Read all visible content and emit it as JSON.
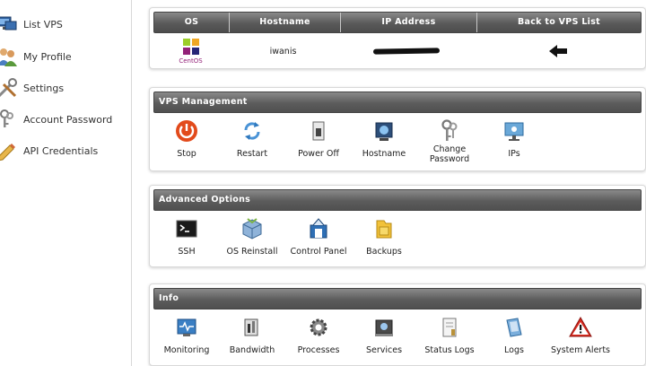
{
  "sidebar": {
    "items": [
      {
        "label": "List VPS",
        "icon": "monitor-icon"
      },
      {
        "label": "My Profile",
        "icon": "users-icon"
      },
      {
        "label": "Settings",
        "icon": "tools-icon"
      },
      {
        "label": "Account Password",
        "icon": "keys-icon"
      },
      {
        "label": "API Credentials",
        "icon": "pencil-icon"
      }
    ]
  },
  "vps_table": {
    "headers": [
      "OS",
      "Hostname",
      "IP Address",
      "Back to VPS List"
    ],
    "row": {
      "os_logo_text": "CentOS",
      "hostname": "iwanis",
      "ip_address_redacted": true
    }
  },
  "vps_management": {
    "title": "VPS Management",
    "items": [
      "Stop",
      "Restart",
      "Power Off",
      "Hostname",
      "Change Password",
      "IPs"
    ]
  },
  "advanced_options": {
    "title": "Advanced Options",
    "items": [
      "SSH",
      "OS Reinstall",
      "Control Panel",
      "Backups"
    ]
  },
  "info": {
    "title": "Info",
    "items": [
      "Monitoring",
      "Bandwidth",
      "Processes",
      "Services",
      "Status Logs",
      "Logs",
      "System Alerts"
    ]
  },
  "colors": {
    "header_gradient_top": "#8a8a8a",
    "header_gradient_bottom": "#4c4c4c",
    "stop_red": "#e24a1b",
    "alert_red": "#d92b20"
  }
}
